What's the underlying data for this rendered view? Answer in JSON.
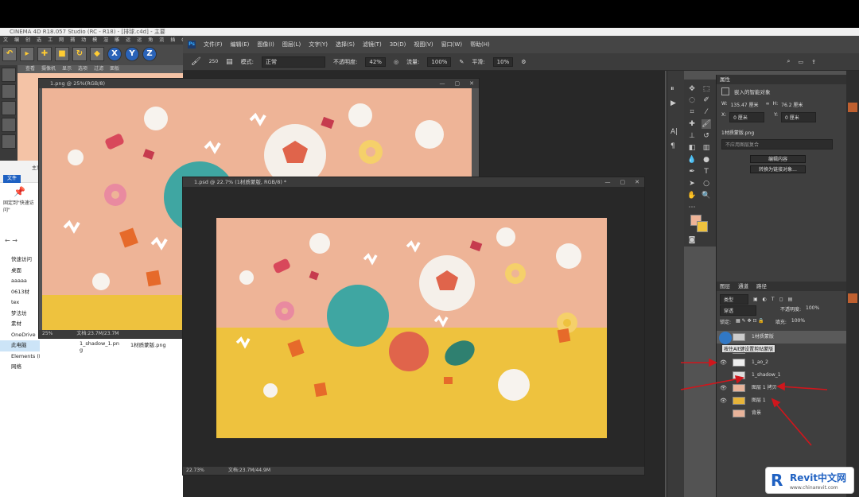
{
  "c4d": {
    "title": "CINEMA 4D R18.057 Studio (RC - R18) - [排球.c4d] - 主要",
    "menu": [
      "文件",
      "编辑",
      "创建",
      "选择",
      "工具",
      "网格",
      "捕捉",
      "动画",
      "模拟",
      "渲染",
      "雕刻",
      "运动跟踪",
      "运动图形",
      "角色",
      "流水线",
      "插件",
      "Octane",
      "脚本",
      "窗口",
      "帮助"
    ],
    "tool_letters": [
      "X",
      "Y",
      "Z"
    ],
    "view_menu": [
      "查看",
      "摄像机",
      "显示",
      "选项",
      "过滤",
      "面板"
    ]
  },
  "explorer": {
    "ribbon_file": "文件",
    "ribbon_home": "主页",
    "pin_text": "固定到\"快速访问\"",
    "nav": [
      "快速访问",
      "桌面",
      "aaaaa",
      "0613材",
      "tex",
      "梦法坊",
      "素材",
      "OneDrive",
      "此电脑",
      "Elements (K:)",
      "网络"
    ],
    "files": [
      "1_shadow_1.png",
      "1材质蒙版.png"
    ]
  },
  "ps": {
    "menu": [
      "文件(F)",
      "编辑(E)",
      "图像(I)",
      "图层(L)",
      "文字(Y)",
      "选择(S)",
      "滤镜(T)",
      "3D(D)",
      "视图(V)",
      "窗口(W)",
      "帮助(H)"
    ],
    "options": {
      "brush_size": "250",
      "mode_label": "模式:",
      "mode_value": "正常",
      "opacity_label": "不透明度:",
      "opacity_value": "42%",
      "flow_label": "流量:",
      "flow_value": "100%",
      "smooth_label": "平滑:",
      "smooth_value": "10%"
    },
    "doc1": {
      "title": "1.png @ 25%(RGB/8)",
      "zoom": "25%",
      "doc_info": "文档:23.7M/23.7M"
    },
    "doc2": {
      "title": "1.psd @ 22.7% (1材质蒙版, RGB/8) *",
      "zoom": "22.73%",
      "doc_info": "文档:23.7M/44.9M"
    },
    "properties": {
      "tabs": [
        "属性"
      ],
      "object_type": "嵌入的智能对象",
      "w_label": "W:",
      "w_value": "135.47 厘米",
      "h_label": "H:",
      "h_value": "76.2 厘米",
      "x_label": "X:",
      "x_value": "0 厘米",
      "y_label": "Y:",
      "y_value": "0 厘米",
      "file_name": "1材质蒙版.png",
      "layer_comp": "不应用图层复合",
      "edit_btn": "编辑内容",
      "convert_btn": "转换为链接对象..."
    },
    "layers": {
      "tabs": [
        "图层",
        "通道",
        "路径"
      ],
      "filter": "类型",
      "mode": "穿透",
      "opacity_label": "不透明度:",
      "opacity_value": "100%",
      "lock_label": "锁定:",
      "fill_label": "填充:",
      "fill_value": "100%",
      "items": [
        {
          "name": "1材质蒙版",
          "visible": false,
          "thumb": "#cccccc"
        },
        {
          "name": "替换 1拷贝",
          "visible": false,
          "thumb": "#d9a080"
        },
        {
          "name": "1_ao_2",
          "visible": true,
          "thumb": "#eeeeee"
        },
        {
          "name": "1_shadow_1",
          "visible": false,
          "thumb": "#dddddd"
        },
        {
          "name": "图层 1 拷贝",
          "visible": true,
          "thumb": "#e8b39a"
        },
        {
          "name": "图层 1",
          "visible": true,
          "thumb": "#e6b43a"
        },
        {
          "name": "背景",
          "visible": false,
          "thumb": "#e8b39a"
        }
      ],
      "tooltip": "按住Alt键设置剪贴蒙版"
    }
  },
  "watermark": {
    "brand": "Revit中文网",
    "url": "www.chinarevit.com"
  },
  "colors": {
    "peach": "#eeb497",
    "yellow": "#eec23e",
    "teal": "#3fa6a2",
    "accent": "#1f61c2",
    "arrow": "#d0161c"
  }
}
